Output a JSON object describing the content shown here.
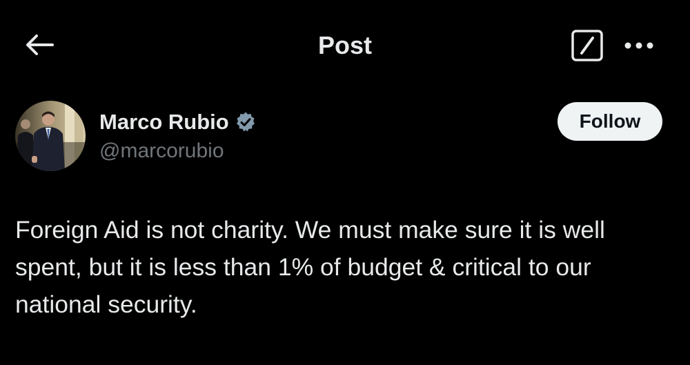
{
  "header": {
    "title": "Post",
    "back_icon": "arrow-left-icon",
    "grok_icon": "grok-icon",
    "more_icon": "more-horizontal-icon"
  },
  "author": {
    "display_name": "Marco Rubio",
    "handle": "@marcorubio",
    "verified_icon": "verified-badge-icon",
    "verified_color": "#829aab"
  },
  "follow_button": {
    "label": "Follow"
  },
  "post": {
    "text": "Foreign Aid is not charity. We must make sure it is well spent, but it is less than 1% of budget & critical to our national security."
  },
  "colors": {
    "background": "#000000",
    "primary_text": "#e7e9ea",
    "secondary_text": "#71767b",
    "follow_button_bg": "#eff3f4",
    "follow_button_text": "#0f1419"
  }
}
